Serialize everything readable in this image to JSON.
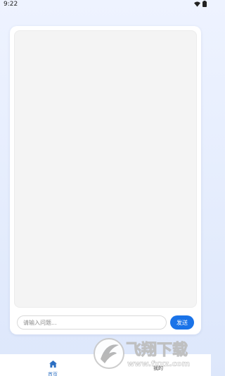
{
  "status_bar": {
    "time": "9:22"
  },
  "chat": {
    "input_placeholder": "请输入问题...",
    "send_label": "发送"
  },
  "nav": {
    "items": [
      {
        "label": "首页",
        "icon": "home-icon",
        "active": true
      },
      {
        "label": "我的",
        "icon": "profile-icon",
        "active": false
      }
    ]
  },
  "watermark": {
    "text_main": "飞翔下载",
    "text_url": "www.fxxz.com"
  },
  "colors": {
    "accent": "#1a73e8",
    "nav_active": "#2c6fc2",
    "background_top": "#eef3ff",
    "background_bottom": "#dde7fb"
  }
}
